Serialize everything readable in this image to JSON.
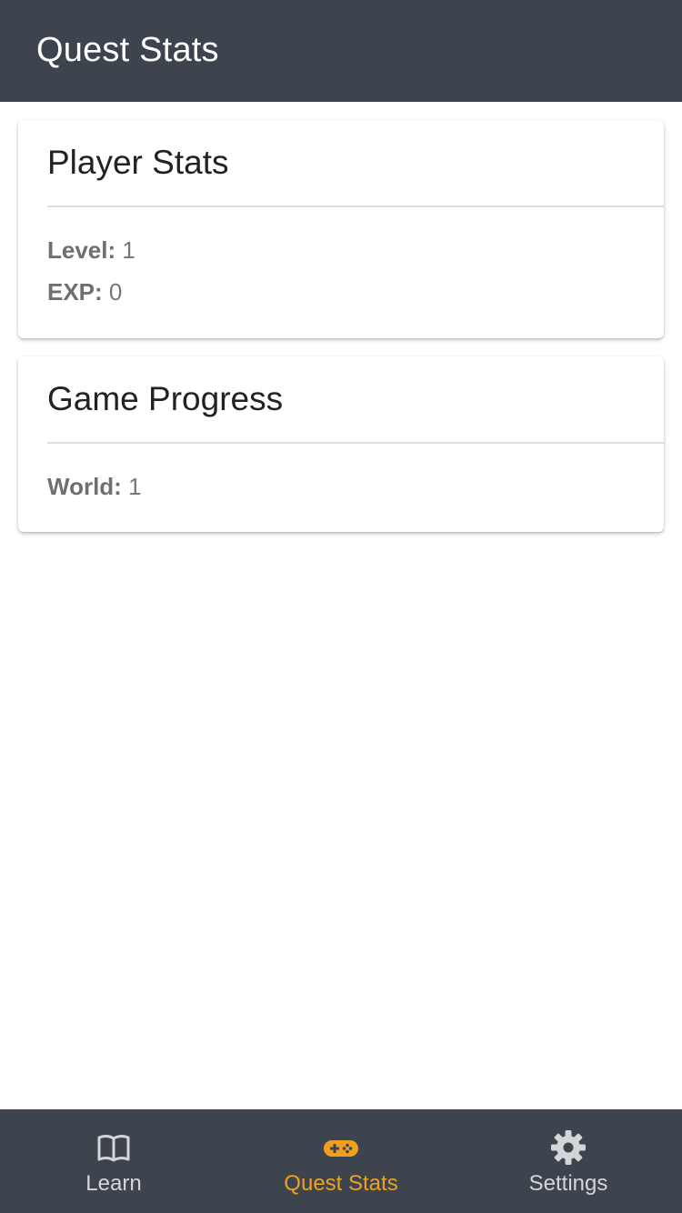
{
  "header": {
    "title": "Quest Stats"
  },
  "cards": {
    "player_stats": {
      "title": "Player Stats",
      "rows": [
        {
          "label": "Level:",
          "value": "1"
        },
        {
          "label": "EXP:",
          "value": "0"
        }
      ]
    },
    "game_progress": {
      "title": "Game Progress",
      "rows": [
        {
          "label": "World:",
          "value": "1"
        }
      ]
    }
  },
  "bottom_nav": {
    "items": [
      {
        "label": "Learn",
        "icon": "book-icon",
        "active": false
      },
      {
        "label": "Quest Stats",
        "icon": "gamepad-icon",
        "active": true
      },
      {
        "label": "Settings",
        "icon": "gear-icon",
        "active": false
      }
    ]
  },
  "colors": {
    "header_bg": "#3e444d",
    "nav_bg": "#3e444d",
    "accent": "#f0a020",
    "nav_inactive": "#d3d5d8"
  }
}
